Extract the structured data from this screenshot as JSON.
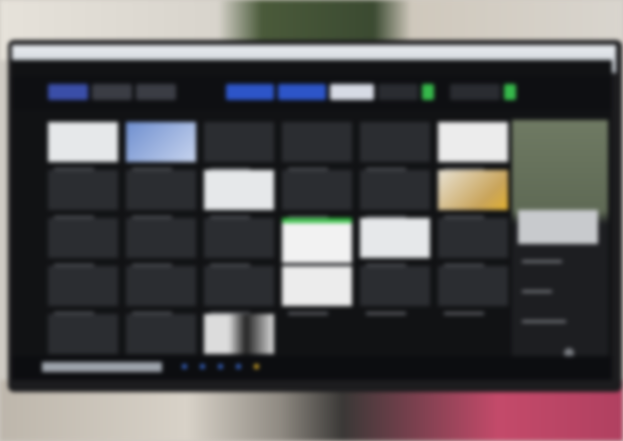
{
  "scene": "blurred-monitor-photo",
  "topbar": {
    "buttons": [
      {
        "name": "nav-button-1",
        "color": "#3a4ea8"
      },
      {
        "name": "nav-button-2",
        "color": "#3b3d44"
      },
      {
        "name": "nav-button-3",
        "color": "#3b3d44"
      },
      {
        "name": "tab-button-1",
        "color": "#2d55c8"
      },
      {
        "name": "tab-button-2",
        "color": "#2d55c8"
      },
      {
        "name": "tab-button-3",
        "color": "#d7dbe5"
      },
      {
        "name": "tab-button-4",
        "color": "#2a2c31"
      },
      {
        "name": "status-indicator",
        "color": "#36b84a"
      },
      {
        "name": "tab-button-5",
        "color": "#2a2c31"
      },
      {
        "name": "status-indicator-2",
        "color": "#36b84a"
      }
    ]
  },
  "grid": {
    "cells": [
      [
        "light",
        "blue",
        "",
        "",
        "",
        "doc"
      ],
      [
        "",
        "",
        "light",
        "",
        "",
        "photo"
      ],
      [
        "",
        "",
        "",
        "doc-green",
        "light",
        ""
      ],
      [
        "",
        "",
        "",
        "doc",
        "",
        ""
      ],
      [
        "",
        "",
        "dark-img"
      ]
    ]
  },
  "status": {
    "dots": [
      "#3a6ad0",
      "#3a6ad0",
      "#3a6ad0",
      "#3a6ad0",
      "#e0b22a"
    ]
  }
}
